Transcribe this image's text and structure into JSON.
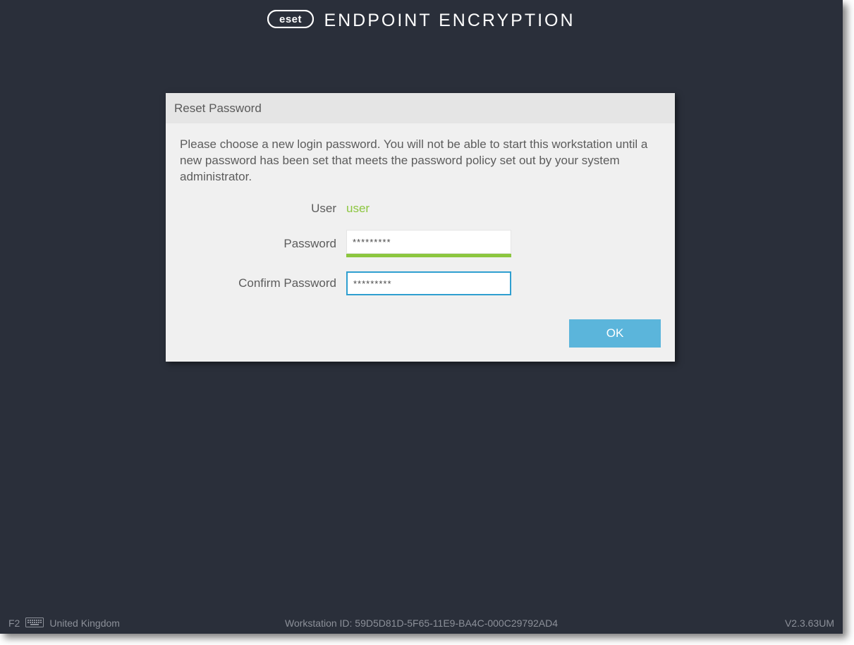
{
  "brand": {
    "logo_text": "eset",
    "product_name": "ENDPOINT ENCRYPTION"
  },
  "panel": {
    "title": "Reset Password",
    "instructions": "Please choose a new login password. You will not be able to start this workstation until a new password has been set that meets the password policy set out by your system administrator.",
    "labels": {
      "user": "User",
      "password": "Password",
      "confirm": "Confirm Password"
    },
    "username": "user",
    "password_value": "*********",
    "confirm_value": "*********",
    "ok_label": "OK"
  },
  "footer": {
    "key_hint": "F2",
    "layout": "United Kingdom",
    "workstation_label": "Workstation ID: 59D5D81D-5F65-11E9-BA4C-000C29792AD4",
    "version": "V2.3.63UM"
  }
}
